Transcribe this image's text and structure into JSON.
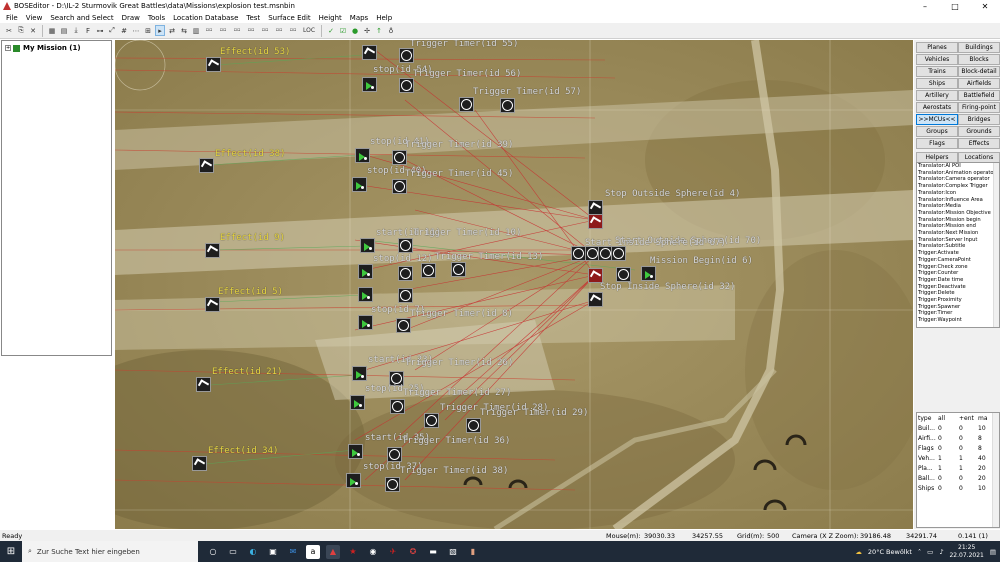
{
  "window": {
    "title": "BOSEditor - D:\\IL-2 Sturmovik Great Battles\\data\\Missions\\explosion test.msnbin"
  },
  "window_controls": {
    "minimize": "–",
    "maximize": "□",
    "close": "✕"
  },
  "menu": [
    "File",
    "View",
    "Search and Select",
    "Draw",
    "Tools",
    "Location Database",
    "Test",
    "Surface Edit",
    "Height",
    "Maps",
    "Help"
  ],
  "toolbar": {
    "loc_label": "LOC"
  },
  "tree": {
    "root": "My Mission (1)",
    "expander": "+"
  },
  "map_labels": [
    {
      "text": "Effect(id 53)",
      "yellow": true
    },
    {
      "text": "Trigger Timer(id 55)",
      "yellow": false
    },
    {
      "text": "stop(id 54)",
      "yellow": false
    },
    {
      "text": "Trigger Timer(id 56)",
      "yellow": false
    },
    {
      "text": "Trigger Timer(id 57)",
      "yellow": false
    },
    {
      "text": "Effect(id 38)",
      "yellow": true
    },
    {
      "text": "stop(id 41)",
      "yellow": false
    },
    {
      "text": "Trigger Timer(id 39)",
      "yellow": false
    },
    {
      "text": "stop(id 40)",
      "yellow": false
    },
    {
      "text": "Trigger Timer(id 45)",
      "yellow": false
    },
    {
      "text": "Stop Outside Sphere(id 4)",
      "yellow": false
    },
    {
      "text": "Effect(id 9)",
      "yellow": true
    },
    {
      "text": "start(id 11)",
      "yellow": false
    },
    {
      "text": "Trigger Timer(id 10)",
      "yellow": false
    },
    {
      "text": "stop(id 12)",
      "yellow": false
    },
    {
      "text": "Trigger Timer(id 13)",
      "yellow": false
    },
    {
      "text": "Start Outside Sphere(id 70)",
      "yellow": false
    },
    {
      "text": "Start Inside Sphere(id 67)",
      "yellow": false
    },
    {
      "text": "Mission Begin(id 6)",
      "yellow": false
    },
    {
      "text": "Effect(id 5)",
      "yellow": true
    },
    {
      "text": "stop(id 7)",
      "yellow": false
    },
    {
      "text": "Trigger Timer(id 8)",
      "yellow": false
    },
    {
      "text": "Stop Inside Sphere(id 32)",
      "yellow": false
    },
    {
      "text": "Effect(id 21)",
      "yellow": true
    },
    {
      "text": "start(id 23)",
      "yellow": false
    },
    {
      "text": "Trigger Timer(id 26)",
      "yellow": false
    },
    {
      "text": "stop(id 25)",
      "yellow": false
    },
    {
      "text": "Trigger Timer(id 27)",
      "yellow": false
    },
    {
      "text": "Trigger Timer(id 28)",
      "yellow": false
    },
    {
      "text": "Trigger Timer(id 29)",
      "yellow": false
    },
    {
      "text": "Effect(id 34)",
      "yellow": true
    },
    {
      "text": "start(id 35)",
      "yellow": false
    },
    {
      "text": "Trigger Timer(id 36)",
      "yellow": false
    },
    {
      "text": "stop(id 37)",
      "yellow": false
    },
    {
      "text": "Trigger Timer(id 38)",
      "yellow": false
    }
  ],
  "right_buttons": [
    "Planes",
    "Buildings",
    "Vehicles",
    "Blocks",
    "Trains",
    "Block-detail",
    "Ships",
    "Airfields",
    "Artillery",
    "Battlefield",
    "Aerostats",
    "Firing-point",
    ">>MCUs<<",
    "Bridges",
    "Groups",
    "Grounds",
    "Flags",
    "Effects",
    "Helpers",
    "Locations"
  ],
  "mcu_list": [
    "Translator:AI POI",
    "Translator:Animation operato",
    "Translator:Camera operator",
    "Translator:Complex Trigger",
    "Translator:Icon",
    "Translator:Influence Area",
    "Translator:Media",
    "Translator:Mission Objective",
    "Translator:Mission begin",
    "Translator:Mission end",
    "Translator:Next Mission",
    "Translator:Server Input",
    "Translator:Subtitle",
    "Trigger:Activate",
    "Trigger:CameraPoint",
    "Trigger:Check zone",
    "Trigger:Counter",
    "Trigger:Date time",
    "Trigger:Deactivate",
    "Trigger:Delete",
    "Trigger:Proximity",
    "Trigger:Spawner",
    "Trigger:Timer",
    "Trigger:Waypoint"
  ],
  "stats": {
    "headers": [
      "type",
      "all",
      "+ent",
      "ma"
    ],
    "rows": [
      [
        "Buil...",
        "0",
        "0",
        "10"
      ],
      [
        "Airfi...",
        "0",
        "0",
        "8"
      ],
      [
        "Flags",
        "0",
        "0",
        "8"
      ],
      [
        "Veh...",
        "1",
        "1",
        "40"
      ],
      [
        "Pla...",
        "1",
        "1",
        "20"
      ],
      [
        "Ball...",
        "0",
        "0",
        "20"
      ],
      [
        "Ships",
        "0",
        "0",
        "10"
      ]
    ]
  },
  "status": {
    "ready": "Ready",
    "mouse_label": "Mouse(m):",
    "mouse_x": "39030.33",
    "mouse_y": "34257.55",
    "grid_label": "Grid(m):",
    "grid_value": "500",
    "camera_label": "Camera (X Z Zoom):",
    "camera_x": "39186.48",
    "camera_z": "34291.74",
    "camera_zoom": "0.141 (1)"
  },
  "taskbar": {
    "search_placeholder": "Zur Suche Text hier eingeben",
    "weather": "20°C  Bewölkt",
    "time": "21:25",
    "date": "22.07.2021"
  },
  "colors": {
    "accent": "#0078d7",
    "map_ground": "#9c8a58",
    "effect_label": "#e8d640",
    "trigger_lines": "#c84030"
  }
}
